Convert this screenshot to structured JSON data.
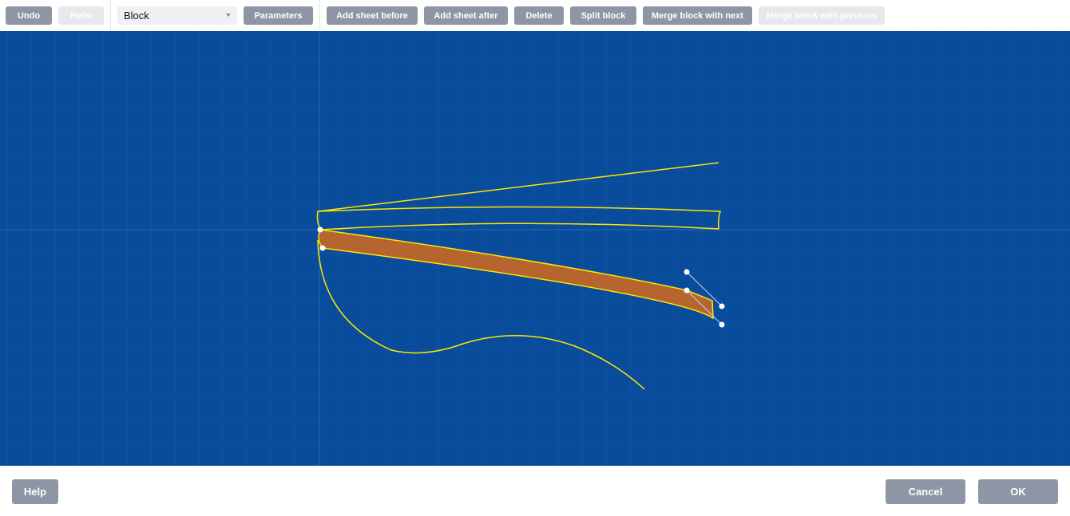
{
  "toolbar": {
    "undo": "Undo",
    "redo": "Redo",
    "mode_select": "Block",
    "parameters": "Parameters",
    "add_sheet_before": "Add sheet before",
    "add_sheet_after": "Add sheet after",
    "delete": "Delete",
    "split_block": "Split block",
    "merge_next": "Merge block with next",
    "merge_previous": "Merge block with previous"
  },
  "footer": {
    "help": "Help",
    "cancel": "Cancel",
    "ok": "OK"
  },
  "colors": {
    "canvas": "#0a4c9c",
    "curve": "#ffe600",
    "selected_fill": "#b5652d",
    "button": "#8e95a4",
    "button_disabled": "#e6e8ec"
  }
}
